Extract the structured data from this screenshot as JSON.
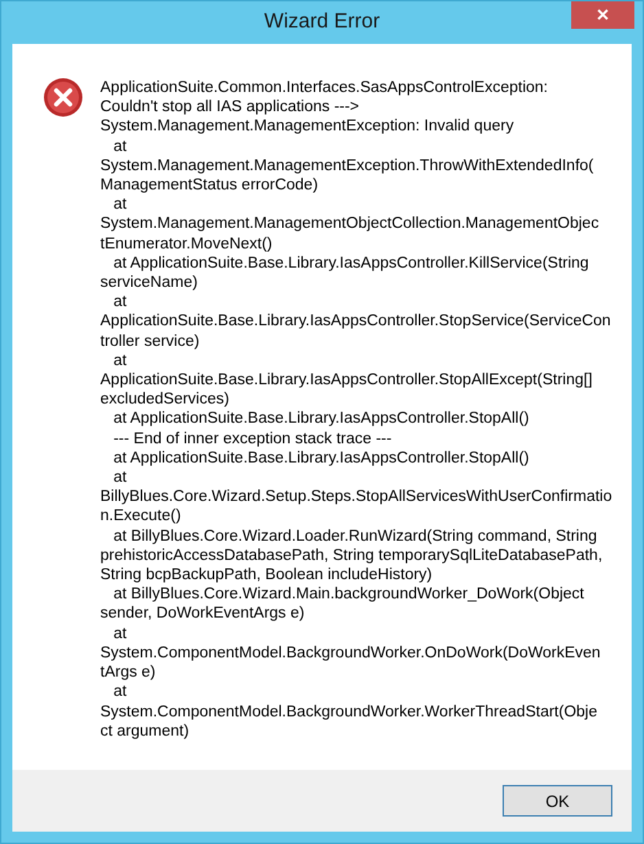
{
  "window": {
    "title": "Wizard Error",
    "close": "✕"
  },
  "message": "ApplicationSuite.Common.Interfaces.SasAppsControlException:\nCouldn't stop all IAS applications --->\nSystem.Management.ManagementException: Invalid query\n   at\nSystem.Management.ManagementException.ThrowWithExtendedInfo(\nManagementStatus errorCode)\n   at\nSystem.Management.ManagementObjectCollection.ManagementObjec\ntEnumerator.MoveNext()\n   at ApplicationSuite.Base.Library.IasAppsController.KillService(String\nserviceName)\n   at\nApplicationSuite.Base.Library.IasAppsController.StopService(ServiceCon\ntroller service)\n   at\nApplicationSuite.Base.Library.IasAppsController.StopAllExcept(String[]\nexcludedServices)\n   at ApplicationSuite.Base.Library.IasAppsController.StopAll()\n   --- End of inner exception stack trace ---\n   at ApplicationSuite.Base.Library.IasAppsController.StopAll()\n   at\nBillyBlues.Core.Wizard.Setup.Steps.StopAllServicesWithUserConfirmatio\nn.Execute()\n   at BillyBlues.Core.Wizard.Loader.RunWizard(String command, String\nprehistoricAccessDatabasePath, String temporarySqlLiteDatabasePath,\nString bcpBackupPath, Boolean includeHistory)\n   at BillyBlues.Core.Wizard.Main.backgroundWorker_DoWork(Object\nsender, DoWorkEventArgs e)\n   at\nSystem.ComponentModel.BackgroundWorker.OnDoWork(DoWorkEven\ntArgs e)\n   at\nSystem.ComponentModel.BackgroundWorker.WorkerThreadStart(Obje\nct argument)",
  "buttons": [
    {
      "label": "OK",
      "focused": true
    }
  ]
}
